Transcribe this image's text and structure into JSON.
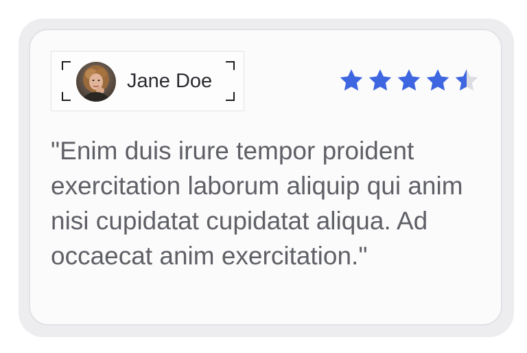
{
  "review": {
    "author": {
      "name": "Jane Doe",
      "avatar_icon": "user-avatar-photo"
    },
    "rating": {
      "value": 4.5,
      "max": 5,
      "star_icon": "star-icon",
      "filled_color": "#3e66e0",
      "empty_color": "#dcdde3"
    },
    "quote": "\"Enim duis irure tempor proident exercitation laborum aliquip qui anim nisi cupidatat cupidatat aliqua. Ad occaecat anim exercitation.\""
  },
  "colors": {
    "accent": "#3e66e0",
    "text": "#5f6066",
    "name_text": "#2a2a30"
  }
}
